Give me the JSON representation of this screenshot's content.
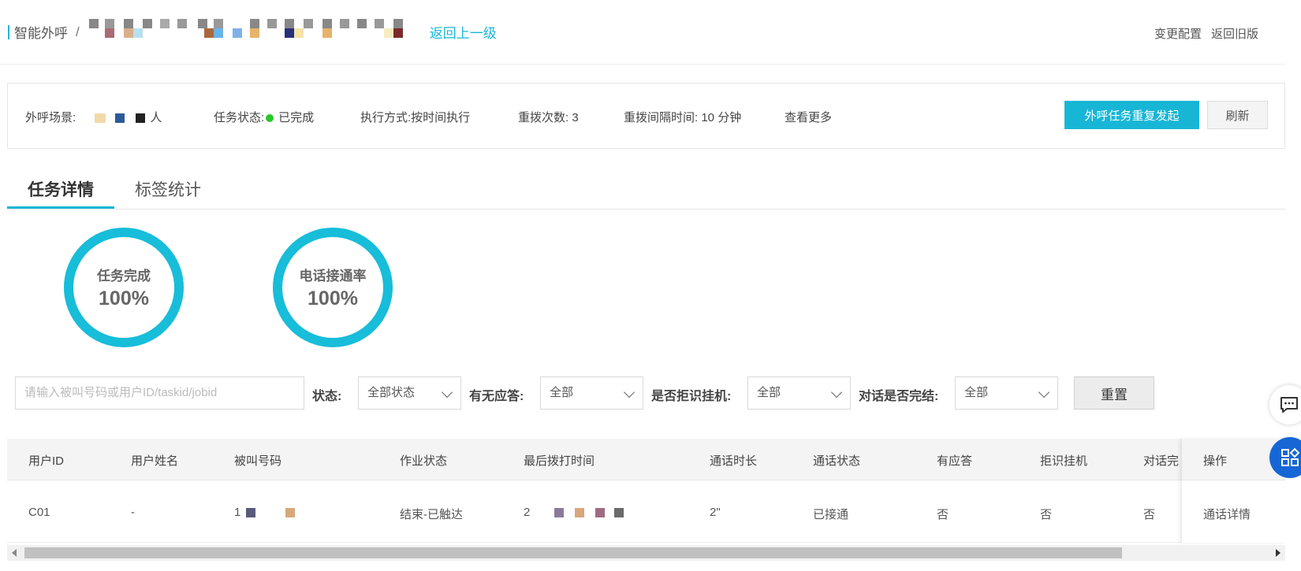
{
  "header": {
    "breadcrumb_root": "智能外呼",
    "separator": "/",
    "back_link": "返回上一级",
    "actions": [
      "变更配置",
      "返回旧版"
    ]
  },
  "info": {
    "scene_label": "外呼场景:",
    "scene_suffix": "人",
    "status_label": "任务状态:",
    "status_value": "已完成",
    "exec_label": "执行方式:",
    "exec_value": "按时间执行",
    "redial_label": "重拨次数:",
    "redial_value": "3",
    "interval_label": "重拨间隔时间:",
    "interval_value": "10 分钟",
    "more_link": "查看更多",
    "restart_button": "外呼任务重复发起",
    "refresh_button": "刷新"
  },
  "tabs": {
    "active": "任务详情",
    "other": "标签统计"
  },
  "stats": {
    "task_label": "任务完成",
    "task_value": "100%",
    "connect_label": "电话接通率",
    "connect_value": "100%"
  },
  "filters": {
    "search_placeholder": "请输入被叫号码或用户ID/taskid/jobid",
    "status_label": "状态:",
    "status_value": "全部状态",
    "answer_label": "有无应答:",
    "answer_value": "全部",
    "reject_label": "是否拒识挂机:",
    "reject_value": "全部",
    "complete_label": "对话是否完结:",
    "complete_value": "全部",
    "reset_button": "重置"
  },
  "table": {
    "columns": [
      "用户ID",
      "用户姓名",
      "被叫号码",
      "作业状态",
      "最后拨打时间",
      "通话时长",
      "通话状态",
      "有应答",
      "拒识挂机",
      "对话完",
      "操作"
    ],
    "rows": [
      {
        "user_id": "C01",
        "user_name": "-",
        "phone_prefix": "1",
        "job_status": "结束-已触达",
        "last_call_prefix": "2",
        "duration": "2\"",
        "call_status": "已接通",
        "answered": "否",
        "rejected": "否",
        "completed": "否",
        "action": "通话详情"
      }
    ]
  },
  "colors": {
    "accent": "#17b6d6",
    "ring": "#17bdd9",
    "status_dot": "#2bc62b",
    "float_button": "#1766d6"
  }
}
